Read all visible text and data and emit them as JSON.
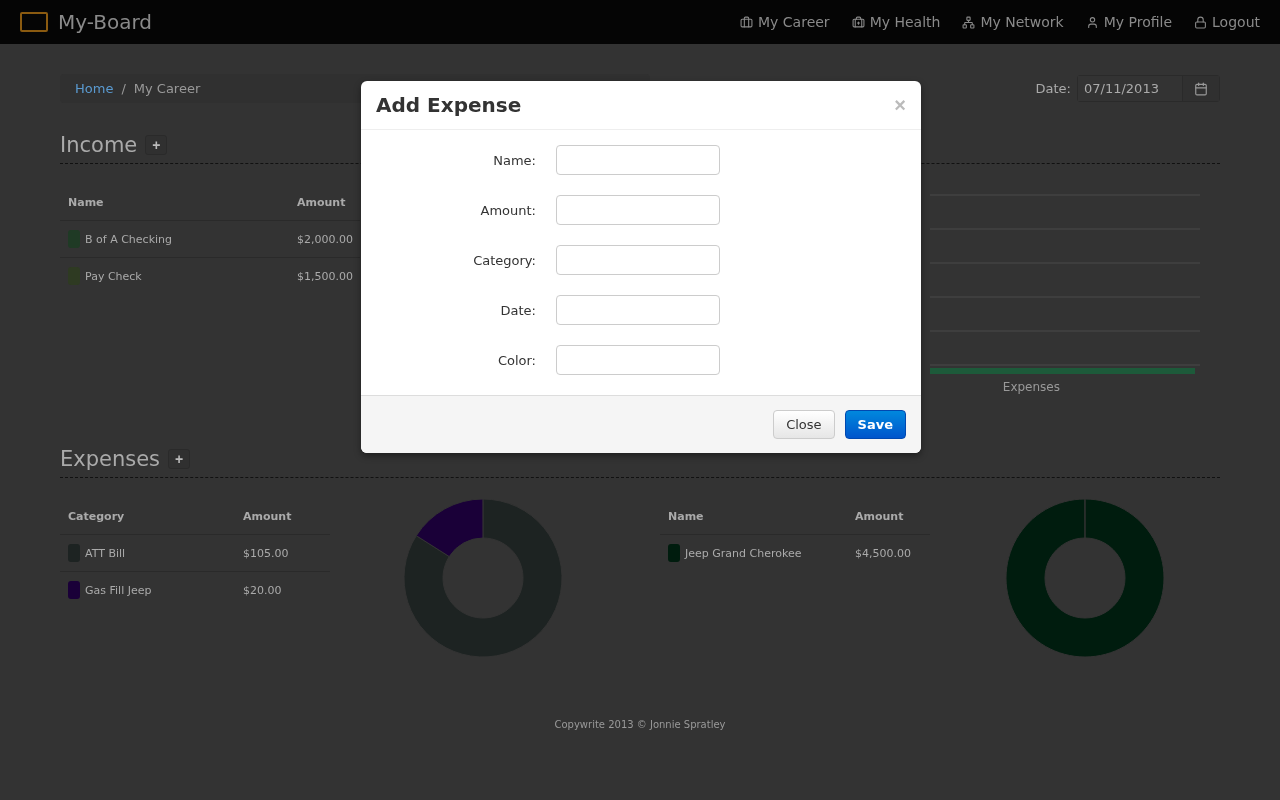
{
  "navbar": {
    "brand": "My-Board",
    "links": [
      {
        "label": "My Career"
      },
      {
        "label": "My Health"
      },
      {
        "label": "My Network"
      },
      {
        "label": "My Profile"
      },
      {
        "label": "Logout"
      }
    ]
  },
  "breadcrumb": [
    {
      "label": "Home",
      "link": true
    },
    {
      "label": "/",
      "link": false
    },
    {
      "label": "My Career",
      "link": false
    }
  ],
  "date_field": {
    "label": "Date:",
    "value": "07/11/2013"
  },
  "income": {
    "title": "Income",
    "add": "+",
    "columns": [
      "Name",
      "Amount"
    ],
    "rows": [
      {
        "name": "B of A Checking",
        "amount": "$2,000.00",
        "color": "#1f3a25"
      },
      {
        "name": "Pay Check",
        "amount": "$1,500.00",
        "color": "#2e3a22"
      }
    ],
    "chart_label": "Expenses"
  },
  "expenses": {
    "title": "Expenses",
    "add": "+",
    "columns": [
      "Category",
      "Amount"
    ],
    "rows": [
      {
        "name": "ATT Bill",
        "amount": "$105.00",
        "color": "#1d2322"
      },
      {
        "name": "Gas Fill Jeep",
        "amount": "$20.00",
        "color": "#1a0038"
      }
    ]
  },
  "assets": {
    "columns": [
      "Name",
      "Amount"
    ],
    "rows": [
      {
        "name": "Jeep Grand Cherokee",
        "amount": "$4,500.00",
        "color": "#001c0e"
      }
    ]
  },
  "footer": "Copywrite 2013 © Jonnie Spratley",
  "modal": {
    "title": "Add Expense",
    "close_icon": "×",
    "fields": [
      {
        "label": "Name:"
      },
      {
        "label": "Amount:"
      },
      {
        "label": "Category:"
      },
      {
        "label": "Date:"
      },
      {
        "label": "Color:"
      }
    ],
    "buttons": [
      {
        "label": "Close",
        "kind": "default"
      },
      {
        "label": "Save",
        "kind": "primary"
      }
    ]
  }
}
